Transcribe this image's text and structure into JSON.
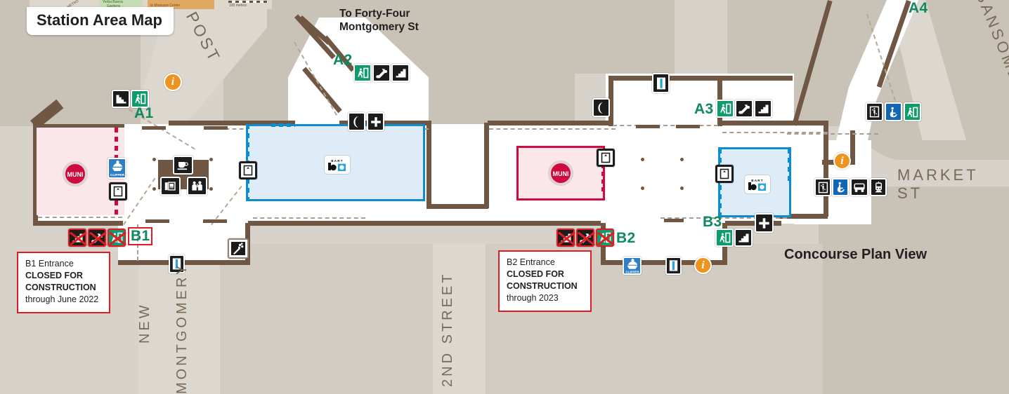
{
  "title_plaque": {
    "label": "Station Area Map"
  },
  "plan_view": {
    "label": "Concourse Plan View"
  },
  "directions": {
    "to_forty_four": "To Forty-Four\nMontgomery St"
  },
  "streets": [
    {
      "name": "POST",
      "orientation": "diagonal"
    },
    {
      "name": "MARKET ST",
      "orientation": "horizontal"
    },
    {
      "name": "SANSOME",
      "orientation": "diagonal"
    },
    {
      "name": "NEW",
      "orientation": "vertical"
    },
    {
      "name": "MONTGOMERY",
      "orientation": "vertical"
    },
    {
      "name": "2ND STREET",
      "orientation": "vertical"
    }
  ],
  "entrances": [
    {
      "id": "A1",
      "status": "open",
      "icons": [
        "stairs-down-icon",
        "exit-icon"
      ]
    },
    {
      "id": "A2",
      "status": "open",
      "icons": [
        "exit-icon",
        "escalator-icon",
        "stairs-icon"
      ]
    },
    {
      "id": "A3",
      "status": "open",
      "icons": [
        "exit-icon",
        "escalator-icon",
        "stairs-icon"
      ]
    },
    {
      "id": "A4",
      "status": "open",
      "icons": [
        "elevator-icon",
        "accessible-icon",
        "exit-icon"
      ]
    },
    {
      "id": "B1",
      "status": "closed",
      "icons": [
        "stairs-icon",
        "escalator-icon",
        "exit-icon"
      ]
    },
    {
      "id": "B2",
      "status": "closed",
      "icons": [
        "stairs-icon",
        "escalator-icon",
        "exit-icon"
      ]
    },
    {
      "id": "B3",
      "status": "open",
      "icons": [
        "exit-icon",
        "stairs-icon"
      ]
    }
  ],
  "notices": [
    {
      "id": "B1",
      "line1": "B1 Entrance",
      "line2": "CLOSED FOR",
      "line3": "CONSTRUCTION",
      "line4": "through June 2022"
    },
    {
      "id": "B2",
      "line1": "B2 Entrance",
      "line2": "CLOSED FOR",
      "line3": "CONSTRUCTION",
      "line4": "through 2023"
    }
  ],
  "paid_areas": [
    {
      "operator": "Muni",
      "logo": "muni-roundel",
      "side": "west"
    },
    {
      "operator": "BART",
      "logo": "bart-logo",
      "side": "center-west"
    },
    {
      "operator": "Muni",
      "logo": "muni-roundel",
      "side": "center-east"
    },
    {
      "operator": "BART",
      "logo": "bart-logo",
      "side": "east"
    }
  ],
  "logos": {
    "bart": "BART",
    "muni": "MUNI",
    "clipper": "CLIPPER"
  },
  "facility_icons": [
    "info-icon",
    "telephone-icon",
    "first-aid-icon",
    "ticket-machine-icon",
    "clipper-icon",
    "faregate-icon",
    "elevator-icon",
    "accessible-icon",
    "bus-icon",
    "light-rail-icon",
    "cafe-icon",
    "newsstand-icon",
    "retail-icon",
    "florist-icon"
  ],
  "inset_map": {
    "labels": [
      "Yerba Buena Gardens",
      "to Moscone Center",
      "100 meters",
      "METRO"
    ]
  },
  "colors": {
    "bart_blue": "#0d8dd0",
    "bart_paid_fill": "#ddecf7",
    "muni_red": "#cf0a40",
    "muni_paid_fill": "#fbe6ea",
    "wall_brown": "#6f5744",
    "entrance_green": "#0f8a5f",
    "closed_red": "#e11b22",
    "info_orange": "#f0921e",
    "land": "#d8d3ca",
    "block": "#c9c2b7"
  }
}
